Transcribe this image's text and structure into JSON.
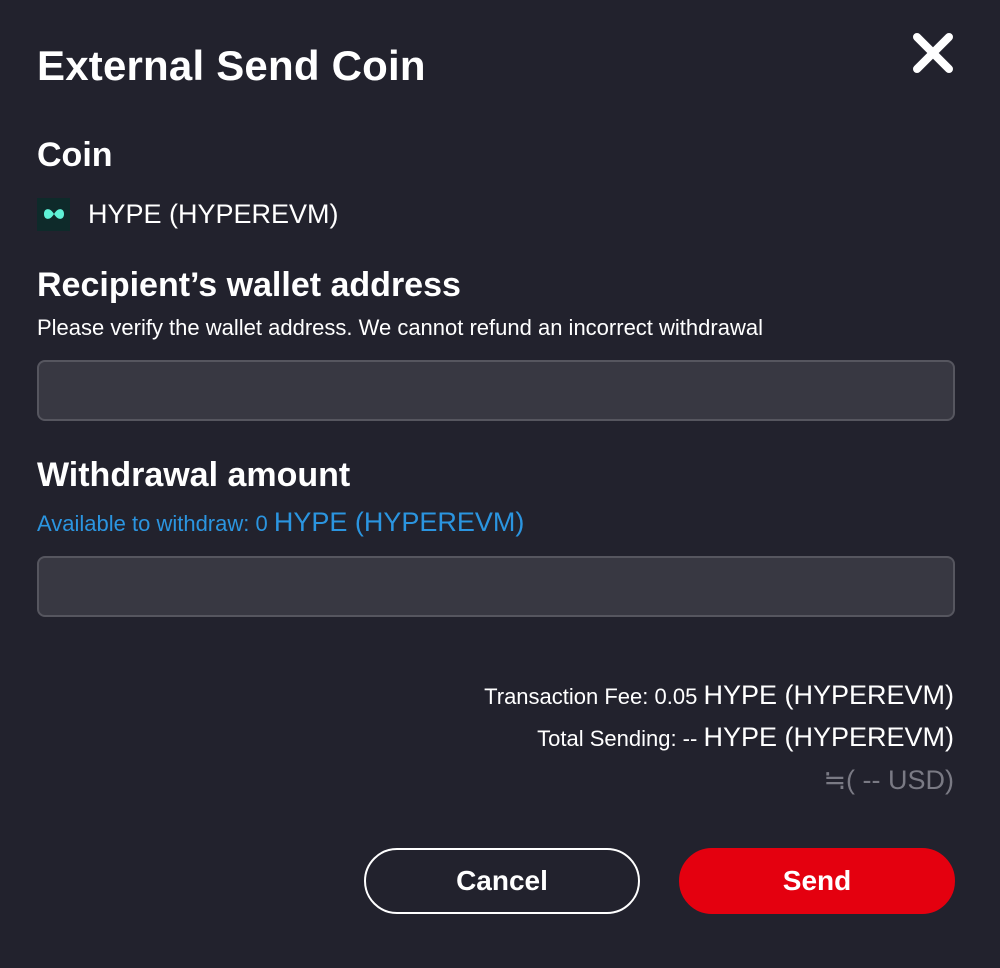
{
  "dialog": {
    "title": "External Send Coin"
  },
  "coin": {
    "label": "Coin",
    "name": "HYPE (HYPEREVM)",
    "logo_icon": "hyperliquid-logo-icon",
    "logo_color": "#5ef2d6"
  },
  "recipient": {
    "label": "Recipient’s wallet address",
    "hint": "Please verify the wallet address. We cannot refund an incorrect withdrawal",
    "value": "",
    "placeholder": ""
  },
  "withdrawal": {
    "label": "Withdrawal amount",
    "available_prefix": "Available to withdraw: 0",
    "available_unit": "HYPE (HYPEREVM)",
    "value": "",
    "placeholder": ""
  },
  "summary": {
    "fee_prefix": "Transaction Fee: 0.05",
    "fee_unit": "HYPE (HYPEREVM)",
    "total_prefix": "Total Sending: --",
    "total_unit": "HYPE (HYPEREVM)",
    "usd": "≒( -- USD)"
  },
  "buttons": {
    "cancel": "Cancel",
    "send": "Send"
  },
  "colors": {
    "background": "#22222d",
    "accent_link": "#2b95e0",
    "send_button": "#e4000f"
  }
}
